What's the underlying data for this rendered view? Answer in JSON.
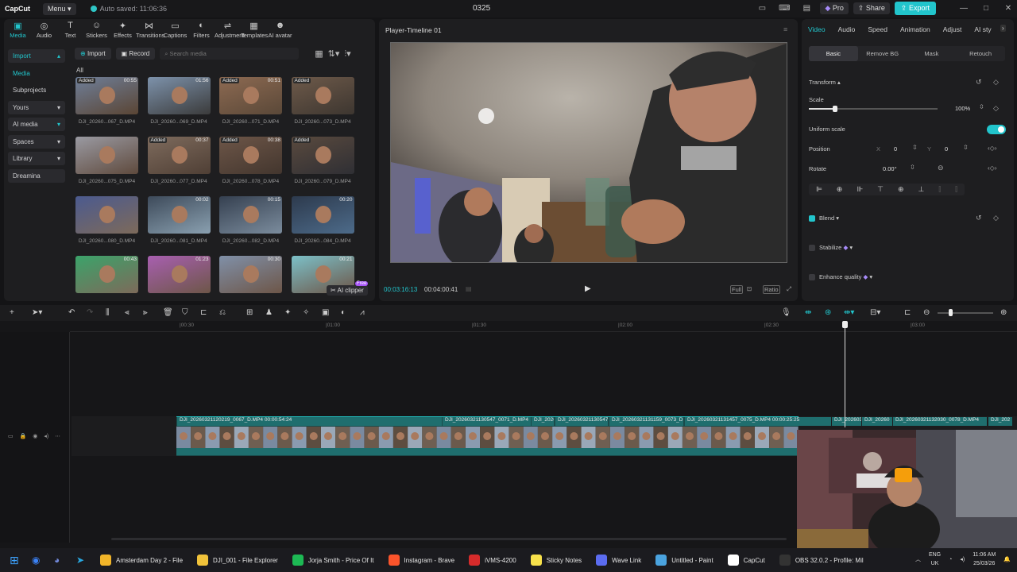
{
  "titlebar": {
    "logo": "CapCut",
    "menu_label": "Menu",
    "autosave": "Auto saved: 11:06:36",
    "project_title": "0325",
    "pro_label": "Pro",
    "share_label": "Share",
    "export_label": "Export"
  },
  "toolbar": {
    "tools": [
      "Media",
      "Audio",
      "Text",
      "Stickers",
      "Effects",
      "Transitions",
      "Captions",
      "Filters",
      "Adjustment",
      "Templates",
      "AI avatar"
    ]
  },
  "leftnav": {
    "items": [
      "Import",
      "Media",
      "Subprojects",
      "Yours",
      "AI media",
      "Spaces",
      "Library",
      "Dreamina"
    ]
  },
  "media": {
    "import_label": "Import",
    "record_label": "Record",
    "search_placeholder": "Search media",
    "all_label": "All",
    "ai_clipper_label": "AI clipper",
    "free_badge": "Free",
    "clips": [
      {
        "name": "DJI_20260...067_D.MP4",
        "badge": "Added",
        "dur": "00:55"
      },
      {
        "name": "DJI_20260...069_D.MP4",
        "badge": "",
        "dur": "01:56"
      },
      {
        "name": "DJI_20260...071_D.MP4",
        "badge": "Added",
        "dur": "00:51"
      },
      {
        "name": "DJI_20260...073_D.MP4",
        "badge": "Added",
        "dur": ""
      },
      {
        "name": "DJI_20260...075_D.MP4",
        "badge": "",
        "dur": ""
      },
      {
        "name": "DJI_20260...077_D.MP4",
        "badge": "Added",
        "dur": "00:37"
      },
      {
        "name": "DJI_20260...078_D.MP4",
        "badge": "Added",
        "dur": "00:38"
      },
      {
        "name": "DJI_20260...079_D.MP4",
        "badge": "Added",
        "dur": ""
      },
      {
        "name": "DJI_20260...080_D.MP4",
        "badge": "",
        "dur": ""
      },
      {
        "name": "DJI_20260...081_D.MP4",
        "badge": "",
        "dur": "00:02"
      },
      {
        "name": "DJI_20260...082_D.MP4",
        "badge": "",
        "dur": "00:15"
      },
      {
        "name": "DJI_20260...084_D.MP4",
        "badge": "",
        "dur": "00:20"
      },
      {
        "name": "",
        "badge": "",
        "dur": "00:43"
      },
      {
        "name": "",
        "badge": "",
        "dur": "01:23"
      },
      {
        "name": "",
        "badge": "",
        "dur": "00:30"
      },
      {
        "name": "",
        "badge": "",
        "dur": "00:21"
      }
    ]
  },
  "player": {
    "title": "Player-Timeline 01",
    "current_time": "00:03:16:13",
    "total_time": "00:04:00:41",
    "full_label": "Full",
    "ratio_label": "Ratio"
  },
  "inspector": {
    "tabs": [
      "Video",
      "Audio",
      "Speed",
      "Animation",
      "Adjust",
      "AI sty"
    ],
    "subtabs": [
      "Basic",
      "Remove BG",
      "Mask",
      "Retouch"
    ],
    "transform_label": "Transform",
    "scale_label": "Scale",
    "scale_value": "100%",
    "scale_fraction": 1.0,
    "uniform_scale_label": "Uniform scale",
    "position_label": "Position",
    "pos_x_label": "X",
    "pos_x": "0",
    "pos_y_label": "Y",
    "pos_y": "0",
    "rotate_label": "Rotate",
    "rotate_value": "0.00°",
    "blend_label": "Blend",
    "stabilize_label": "Stabilize",
    "enhance_label": "Enhance quality"
  },
  "timeline": {
    "ruler": [
      "|00:30",
      "|01:00",
      "|01:30",
      "|02:00",
      "|02:30",
      "|03:00"
    ],
    "clips": [
      "DJI_20260321120219_0067_D.MP4  00:00:54:24",
      "DJI_20260321130547_0071_D.MP4",
      "DJI_2026",
      "DJI_20260321130547",
      "DJI_20260321131159_0073_D",
      "DJI_20260321131457_0075_D.MP4  00:00:25:25",
      "DJI_20260321131",
      "DJI_20260",
      "DJI_20260321132030_0078_D.MP4",
      "DJI_202"
    ]
  },
  "taskbar": {
    "items": [
      {
        "label": "Amsterdam Day 2 - File",
        "color": "#f0b429"
      },
      {
        "label": "DJI_001 - File Explorer",
        "color": "#f0c23a"
      },
      {
        "label": "Jorja Smith - Price Of It",
        "color": "#1db954"
      },
      {
        "label": "Instagram - Brave",
        "color": "#fb542b"
      },
      {
        "label": "iVMS-4200",
        "color": "#d62b2b"
      },
      {
        "label": "Sticky Notes",
        "color": "#f7e14b"
      },
      {
        "label": "Wave Link",
        "color": "#5b6cf0"
      },
      {
        "label": "Untitled - Paint",
        "color": "#4aa3df"
      },
      {
        "label": "CapCut",
        "color": "#ffffff"
      },
      {
        "label": "OBS 32.0.2 - Profile: Mil",
        "color": "#333333"
      }
    ],
    "lang": "ENG",
    "region": "UK",
    "time": "11:06 AM",
    "date": "25/03/26"
  }
}
